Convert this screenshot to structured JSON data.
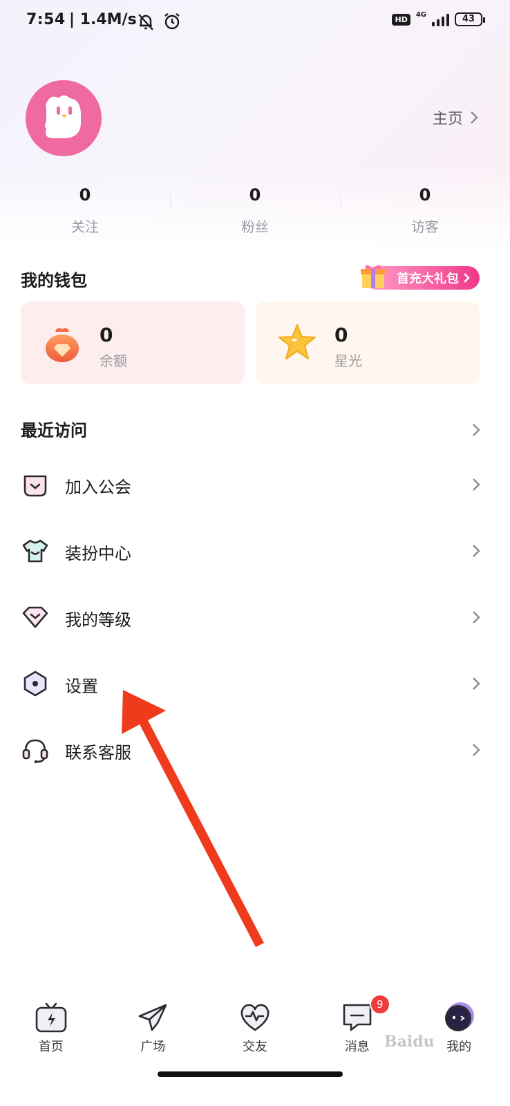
{
  "status_bar": {
    "time": "7:54",
    "network_speed": "| 1.4M/s",
    "hd_label": "HD",
    "network_type": "4G",
    "battery": "43"
  },
  "profile": {
    "home_link": "主页"
  },
  "stats": [
    {
      "value": "0",
      "label": "关注"
    },
    {
      "value": "0",
      "label": "粉丝"
    },
    {
      "value": "0",
      "label": "访客"
    }
  ],
  "wallet": {
    "title": "我的钱包",
    "gift_banner": "首充大礼包",
    "balance": {
      "value": "0",
      "label": "余额"
    },
    "starlight": {
      "value": "0",
      "label": "星光"
    }
  },
  "menu": {
    "recent": "最近访问",
    "items": [
      {
        "label": "加入公会",
        "icon": "guild-icon"
      },
      {
        "label": "装扮中心",
        "icon": "shirt-icon"
      },
      {
        "label": "我的等级",
        "icon": "level-heart-icon"
      },
      {
        "label": "设置",
        "icon": "settings-hex-icon"
      },
      {
        "label": "联系客服",
        "icon": "headset-icon"
      }
    ]
  },
  "bottom_nav": {
    "items": [
      {
        "label": "首页",
        "icon": "tv-icon"
      },
      {
        "label": "广场",
        "icon": "paper-plane-icon"
      },
      {
        "label": "交友",
        "icon": "heart-pulse-icon"
      },
      {
        "label": "消息",
        "icon": "message-icon"
      },
      {
        "label": "我的",
        "icon": "avatar-icon"
      }
    ],
    "message_badge": "9"
  },
  "colors": {
    "accent_pink": "#f06aa2",
    "annotation_arrow": "#f03a1c",
    "badge_red": "#ee3b3b"
  },
  "watermark": "Baidu"
}
